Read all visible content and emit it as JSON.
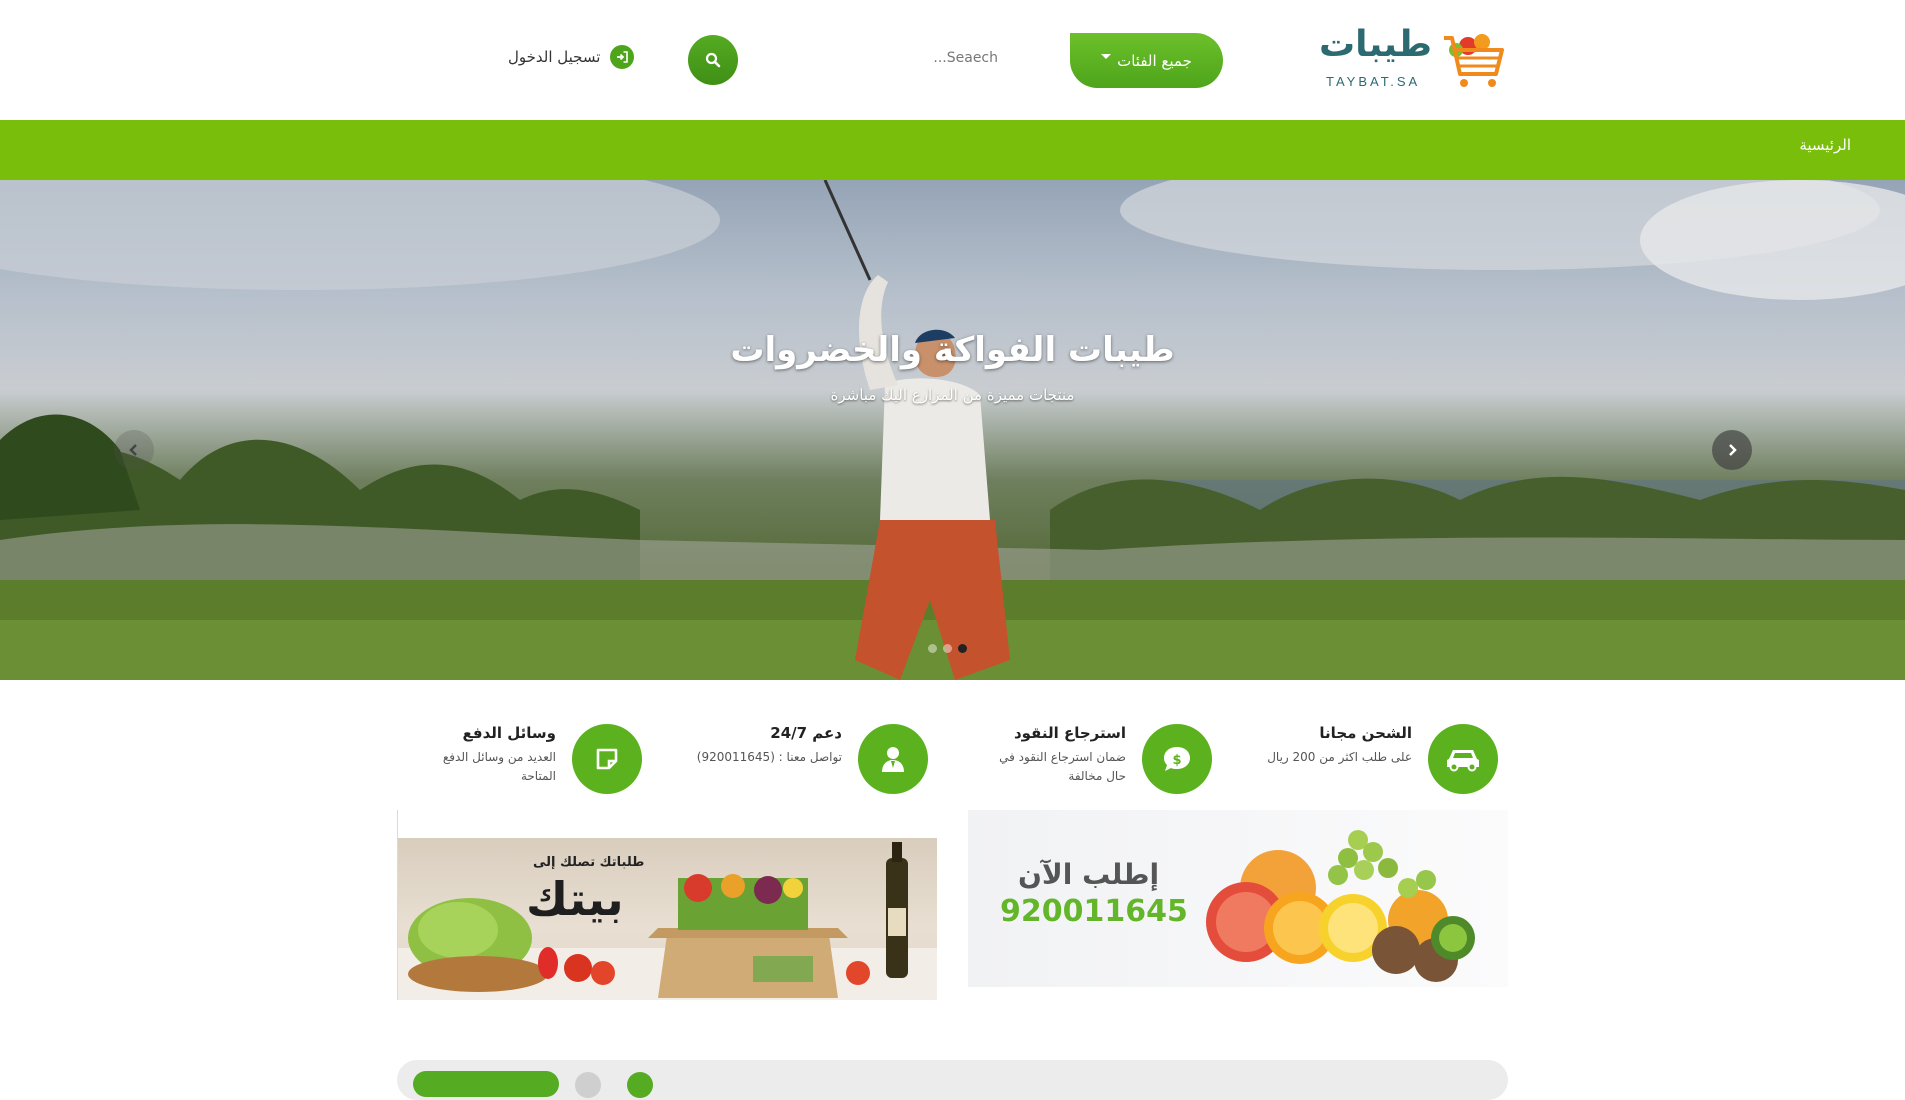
{
  "header": {
    "logo_arabic": "طيبات",
    "logo_english": "TAYBAT.SA",
    "categories_label": "جميع الفئات",
    "search_placeholder": "Seaech...",
    "login_label": "تسجيل الدخول"
  },
  "nav": {
    "home_label": "الرئيسية"
  },
  "hero": {
    "title": "طيبات الفواكة والخضروات",
    "subtitle": "منتجات مميزة من المزارع اليك مباشرة",
    "slide_count": 3,
    "active_slide": 3
  },
  "features": [
    {
      "icon": "car-icon",
      "title": "الشحن مجانا",
      "desc": "على طلب اكثر من 200 ريال"
    },
    {
      "icon": "dollar-icon",
      "title": "استرجاع النقود",
      "desc": "ضمان استرجاع النقود في حال مخالفة"
    },
    {
      "icon": "support-agent-icon",
      "title": "دعم 24/7",
      "desc": "تواصل معنا : (920011645)"
    },
    {
      "icon": "note-icon",
      "title": "وسائل الدفع",
      "desc": "العديد من وسائل الدفع المتاحة"
    }
  ],
  "banners": {
    "left_tag": "طلباتك تصلك إلى",
    "left_big": "بيتك",
    "right_title": "إطلب الآن",
    "right_phone": "920011645"
  },
  "colors": {
    "brand_green": "#78be0b",
    "accent_green": "#5cb21e",
    "logo_teal": "#2c6a72"
  }
}
